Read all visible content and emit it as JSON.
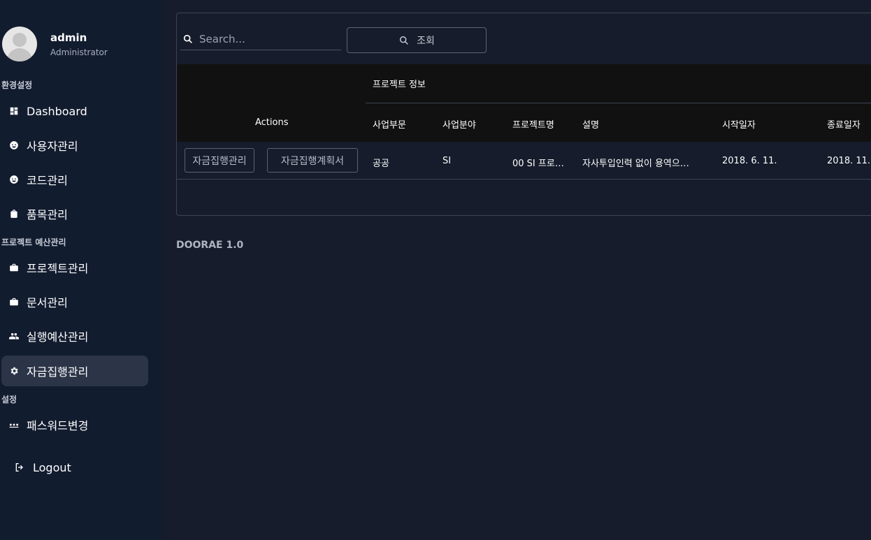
{
  "user": {
    "name": "admin",
    "role": "Administrator"
  },
  "sidebar": {
    "sections": [
      {
        "title": "환경설정"
      },
      {
        "title": "프로젝트 예산관리"
      },
      {
        "title": "설정"
      }
    ],
    "items": [
      {
        "label": "Dashboard",
        "icon": "dashboard-icon"
      },
      {
        "label": "사용자관리",
        "icon": "face-icon"
      },
      {
        "label": "코드관리",
        "icon": "face-icon"
      },
      {
        "label": "품목관리",
        "icon": "shopping-bag-icon"
      },
      {
        "label": "프로젝트관리",
        "icon": "briefcase-icon"
      },
      {
        "label": "문서관리",
        "icon": "briefcase-icon"
      },
      {
        "label": "실행예산관리",
        "icon": "people-icon"
      },
      {
        "label": "자금집행관리",
        "icon": "gear-icon",
        "active": true
      },
      {
        "label": "패스워드변경",
        "icon": "password-dots-icon"
      }
    ],
    "logout": "Logout"
  },
  "search": {
    "placeholder": "Search...",
    "button_label": "조회"
  },
  "table": {
    "actions_header": "Actions",
    "group_header": "프로젝트 정보",
    "columns": [
      "사업부문",
      "사업분야",
      "프로젝트명",
      "설명",
      "시작일자",
      "종료일자"
    ],
    "rows": [
      {
        "actions": [
          "자금집행관리",
          "자금집행계획서"
        ],
        "cells": [
          "공공",
          "SI",
          "00 SI 프로…",
          "자사투입인력 없이 용역으…",
          "2018. 6. 11.",
          "2018. 11."
        ]
      }
    ]
  },
  "footer": {
    "brand": "DOORAE 1.0"
  },
  "colors": {
    "sidebar_bg": "#121c2f",
    "main_bg": "#161c2b",
    "active_item_bg": "#2c3548",
    "table_header_bg": "#111111"
  }
}
